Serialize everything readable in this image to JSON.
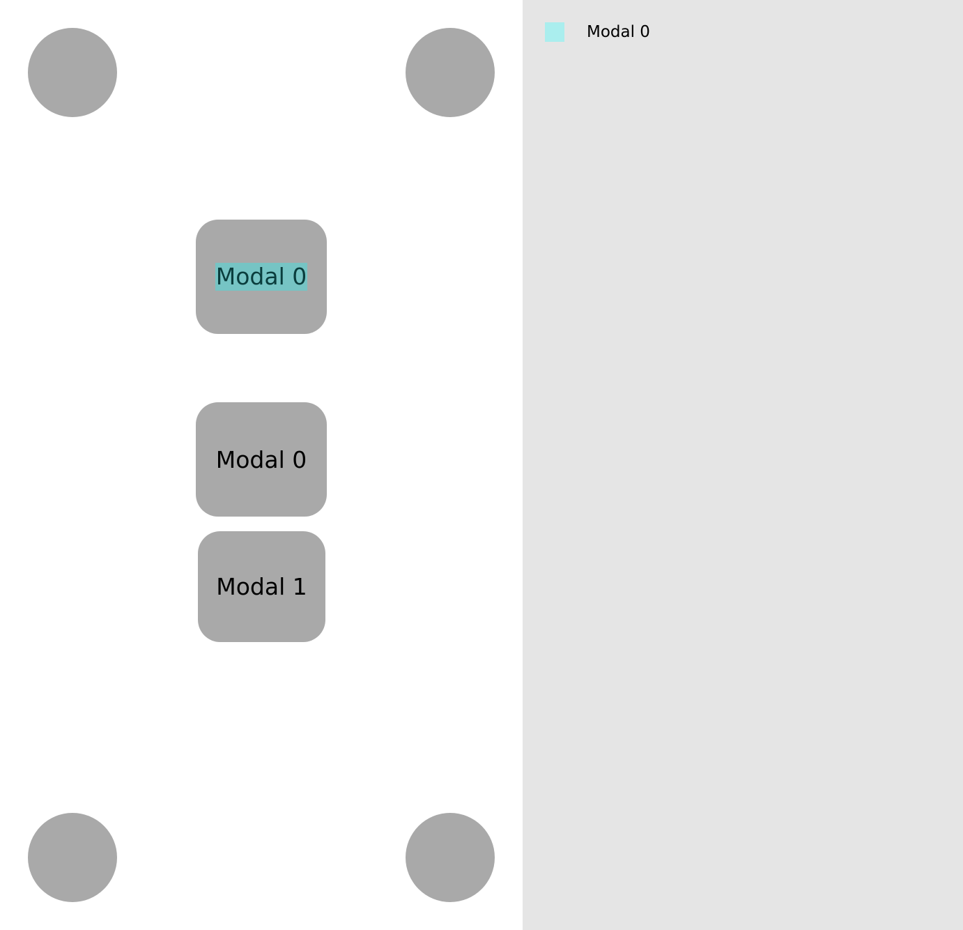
{
  "canvas": {
    "corner_circles": [
      "circle-top-left",
      "circle-top-right",
      "circle-bottom-left",
      "circle-bottom-right"
    ],
    "modals": [
      {
        "label": "Modal 0",
        "highlighted": true
      },
      {
        "label": "Modal 0",
        "highlighted": false
      },
      {
        "label": "Modal 1",
        "highlighted": false
      }
    ]
  },
  "side_panel": {
    "legend": [
      {
        "label": "Modal 0",
        "color": "#aaeeee"
      }
    ]
  },
  "colors": {
    "shape_fill": "#a9a9a9",
    "highlight": "#76c4c4",
    "panel_bg": "#e5e5e5"
  }
}
